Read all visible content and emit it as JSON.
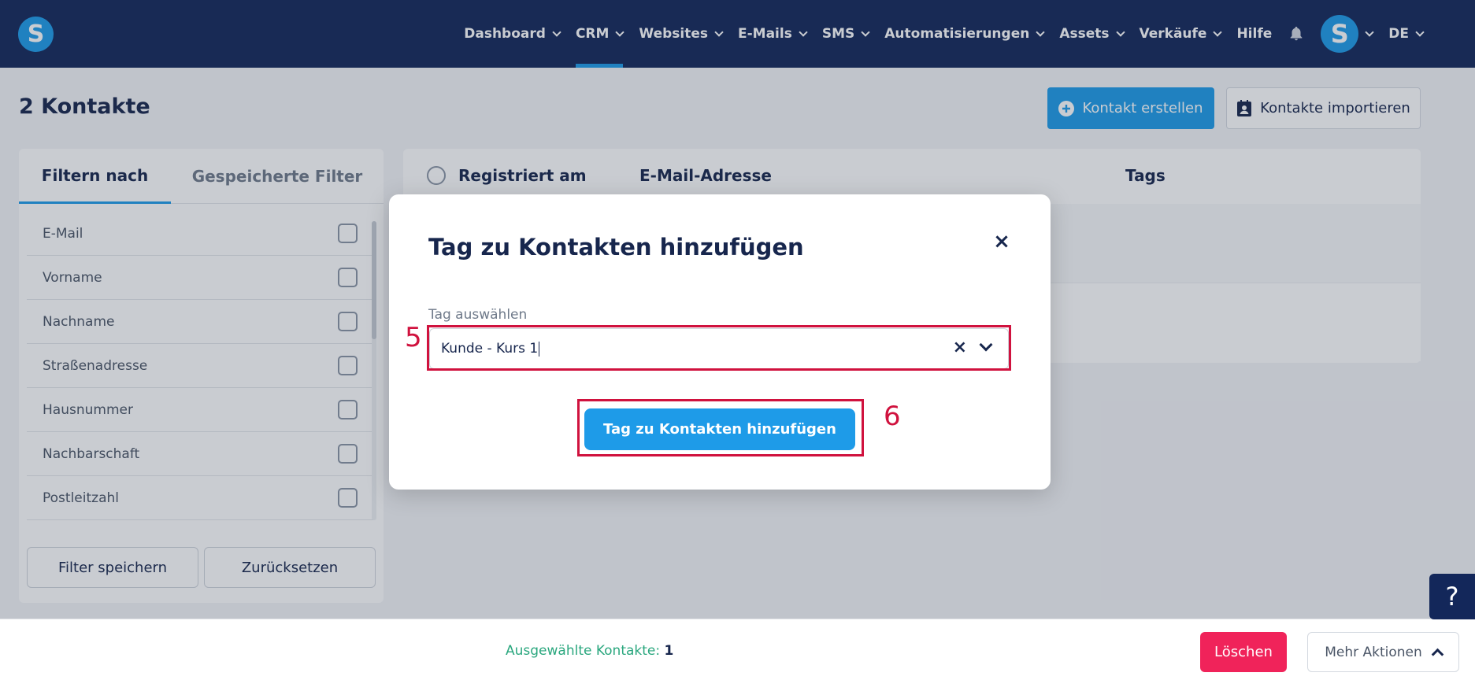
{
  "nav": {
    "logo": "S",
    "items": [
      {
        "label": "Dashboard",
        "dropdown": true,
        "active": false
      },
      {
        "label": "CRM",
        "dropdown": true,
        "active": true
      },
      {
        "label": "Websites",
        "dropdown": true,
        "active": false
      },
      {
        "label": "E-Mails",
        "dropdown": true,
        "active": false
      },
      {
        "label": "SMS",
        "dropdown": true,
        "active": false
      },
      {
        "label": "Automatisierungen",
        "dropdown": true,
        "active": false
      },
      {
        "label": "Assets",
        "dropdown": true,
        "active": false
      },
      {
        "label": "Verkäufe",
        "dropdown": true,
        "active": false
      },
      {
        "label": "Hilfe",
        "dropdown": false,
        "active": false
      }
    ],
    "notifications_icon": "bell-icon",
    "avatar_letter": "S",
    "language": "DE"
  },
  "page": {
    "title": "2 Kontakte",
    "create_button": "Kontakt erstellen",
    "import_button": "Kontakte importieren"
  },
  "filter": {
    "tabs": [
      "Filtern nach",
      "Gespeicherte Filter"
    ],
    "items": [
      "E-Mail",
      "Vorname",
      "Nachname",
      "Straßenadresse",
      "Hausnummer",
      "Nachbarschaft",
      "Postleitzahl"
    ],
    "save_button": "Filter speichern",
    "reset_button": "Zurücksetzen"
  },
  "table": {
    "columns": [
      "Registriert am",
      "E-Mail-Adresse",
      "Tags"
    ]
  },
  "footer": {
    "selected_label": "Ausgewählte Kontakte:",
    "selected_count": "1",
    "delete_button": "Löschen",
    "more_button": "Mehr Aktionen"
  },
  "help_button": "?",
  "modal": {
    "title": "Tag zu Kontakten hinzufügen",
    "close": "×",
    "field_label": "Tag auswählen",
    "field_value": "Kunde - Kurs 1",
    "clear": "×",
    "submit_button": "Tag zu Kontakten hinzufügen",
    "step_select": "5",
    "step_submit": "6"
  },
  "colors": {
    "navbar": "#13275a",
    "accent": "#1e9be8",
    "danger": "#f0235a",
    "highlight": "#d0123e",
    "success": "#2aa77e"
  }
}
